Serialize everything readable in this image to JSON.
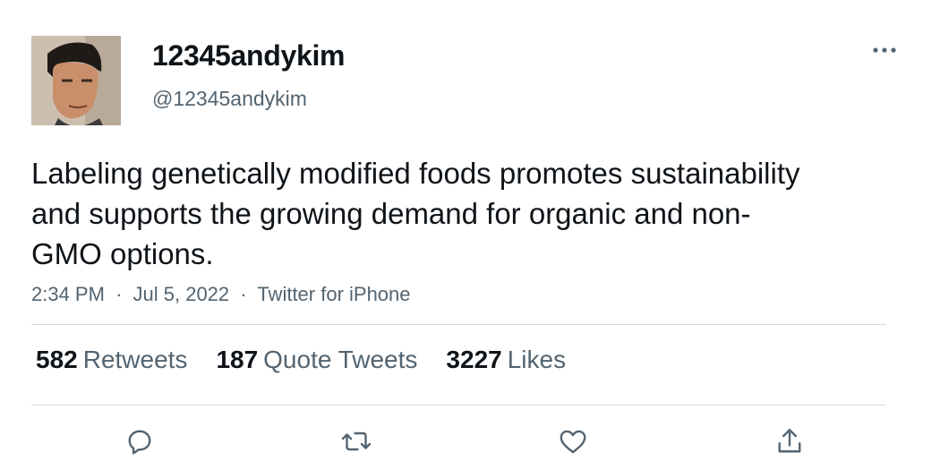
{
  "author": {
    "display_name": "12345andykim",
    "handle": "@12345andykim"
  },
  "tweet": {
    "text": "Labeling genetically modified foods promotes sustainability and supports the growing demand for organic and non-GMO options.",
    "time": "2:34 PM",
    "date": "Jul 5, 2022",
    "source": "Twitter for iPhone",
    "separator": "·"
  },
  "stats": {
    "retweets": {
      "count": "582",
      "label": "Retweets"
    },
    "quotes": {
      "count": "187",
      "label": "Quote Tweets"
    },
    "likes": {
      "count": "3227",
      "label": "Likes"
    }
  },
  "icons": {
    "more": "more-horizontal-icon",
    "reply": "reply-icon",
    "retweet": "retweet-icon",
    "like": "heart-icon",
    "share": "share-icon"
  },
  "colors": {
    "text": "#0f1419",
    "secondary": "#536471",
    "divider": "#d6d9dc",
    "background": "#ffffff"
  }
}
